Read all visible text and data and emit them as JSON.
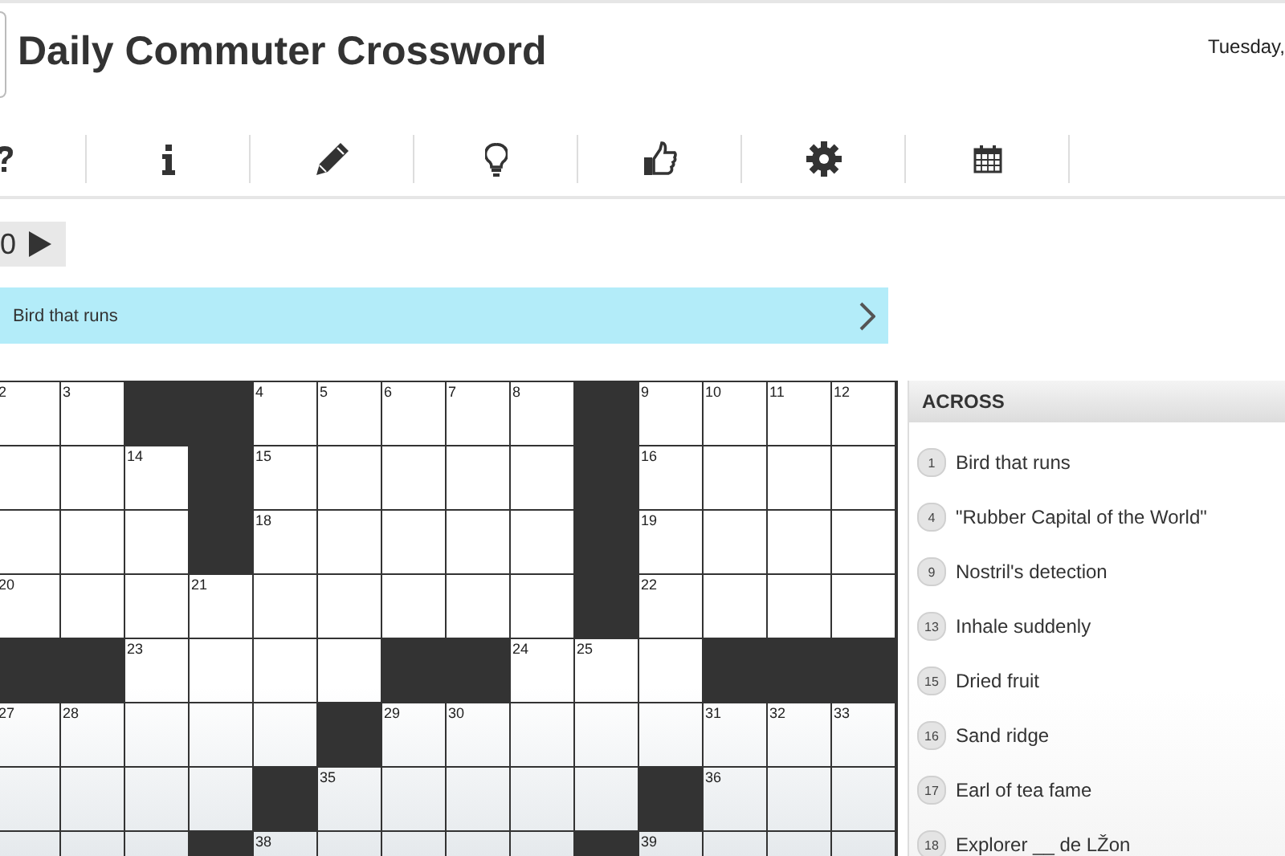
{
  "header": {
    "title": "Daily Commuter Crossword",
    "date": "Tuesday,"
  },
  "toolbar": [
    {
      "kind": "help"
    },
    {
      "kind": "info"
    },
    {
      "kind": "pencil"
    },
    {
      "kind": "bulb"
    },
    {
      "kind": "thumb"
    },
    {
      "kind": "gear"
    },
    {
      "kind": "calendar"
    }
  ],
  "timer": {
    "text": "0"
  },
  "clue_bar": {
    "text": "Bird that runs"
  },
  "grid": [
    [
      {
        "kind": "open",
        "number": "2"
      },
      {
        "kind": "open",
        "number": "3"
      },
      {
        "kind": "block"
      },
      {
        "kind": "block"
      },
      {
        "kind": "open",
        "number": "4"
      },
      {
        "kind": "open",
        "number": "5"
      },
      {
        "kind": "open",
        "number": "6"
      },
      {
        "kind": "open",
        "number": "7"
      },
      {
        "kind": "open",
        "number": "8"
      },
      {
        "kind": "block"
      },
      {
        "kind": "open",
        "number": "9"
      },
      {
        "kind": "open",
        "number": "10"
      },
      {
        "kind": "open",
        "number": "11"
      },
      {
        "kind": "open",
        "number": "12"
      }
    ],
    [
      {
        "kind": "open"
      },
      {
        "kind": "open"
      },
      {
        "kind": "open",
        "number": "14"
      },
      {
        "kind": "block"
      },
      {
        "kind": "open",
        "number": "15"
      },
      {
        "kind": "open"
      },
      {
        "kind": "open"
      },
      {
        "kind": "open"
      },
      {
        "kind": "open"
      },
      {
        "kind": "block"
      },
      {
        "kind": "open",
        "number": "16"
      },
      {
        "kind": "open"
      },
      {
        "kind": "open"
      },
      {
        "kind": "open"
      }
    ],
    [
      {
        "kind": "open"
      },
      {
        "kind": "open"
      },
      {
        "kind": "open"
      },
      {
        "kind": "block"
      },
      {
        "kind": "open",
        "number": "18"
      },
      {
        "kind": "open"
      },
      {
        "kind": "open"
      },
      {
        "kind": "open"
      },
      {
        "kind": "open"
      },
      {
        "kind": "block"
      },
      {
        "kind": "open",
        "number": "19"
      },
      {
        "kind": "open"
      },
      {
        "kind": "open"
      },
      {
        "kind": "open"
      }
    ],
    [
      {
        "kind": "open",
        "number": "20"
      },
      {
        "kind": "open"
      },
      {
        "kind": "open"
      },
      {
        "kind": "open",
        "number": "21"
      },
      {
        "kind": "open"
      },
      {
        "kind": "open"
      },
      {
        "kind": "open"
      },
      {
        "kind": "open"
      },
      {
        "kind": "open"
      },
      {
        "kind": "block"
      },
      {
        "kind": "open",
        "number": "22"
      },
      {
        "kind": "open"
      },
      {
        "kind": "open"
      },
      {
        "kind": "open"
      }
    ],
    [
      {
        "kind": "block"
      },
      {
        "kind": "block"
      },
      {
        "kind": "open",
        "number": "23"
      },
      {
        "kind": "open"
      },
      {
        "kind": "open"
      },
      {
        "kind": "open"
      },
      {
        "kind": "block"
      },
      {
        "kind": "block"
      },
      {
        "kind": "open",
        "number": "24"
      },
      {
        "kind": "open",
        "number": "25"
      },
      {
        "kind": "open"
      },
      {
        "kind": "block"
      },
      {
        "kind": "block"
      },
      {
        "kind": "block"
      }
    ],
    [
      {
        "kind": "open",
        "number": "27"
      },
      {
        "kind": "open",
        "number": "28"
      },
      {
        "kind": "open"
      },
      {
        "kind": "open"
      },
      {
        "kind": "open"
      },
      {
        "kind": "block"
      },
      {
        "kind": "open",
        "number": "29"
      },
      {
        "kind": "open",
        "number": "30"
      },
      {
        "kind": "open"
      },
      {
        "kind": "open"
      },
      {
        "kind": "open"
      },
      {
        "kind": "open",
        "number": "31"
      },
      {
        "kind": "open",
        "number": "32"
      },
      {
        "kind": "open",
        "number": "33"
      }
    ],
    [
      {
        "kind": "open"
      },
      {
        "kind": "open"
      },
      {
        "kind": "open"
      },
      {
        "kind": "open"
      },
      {
        "kind": "block"
      },
      {
        "kind": "open",
        "number": "35"
      },
      {
        "kind": "open"
      },
      {
        "kind": "open"
      },
      {
        "kind": "open"
      },
      {
        "kind": "open"
      },
      {
        "kind": "block"
      },
      {
        "kind": "open",
        "number": "36"
      },
      {
        "kind": "open"
      },
      {
        "kind": "open"
      }
    ],
    [
      {
        "kind": "open"
      },
      {
        "kind": "open"
      },
      {
        "kind": "open"
      },
      {
        "kind": "block"
      },
      {
        "kind": "open",
        "number": "38"
      },
      {
        "kind": "open"
      },
      {
        "kind": "open"
      },
      {
        "kind": "open"
      },
      {
        "kind": "open"
      },
      {
        "kind": "block"
      },
      {
        "kind": "open",
        "number": "39"
      },
      {
        "kind": "open"
      },
      {
        "kind": "open"
      },
      {
        "kind": "open"
      }
    ]
  ],
  "across": {
    "title": "ACROSS",
    "clues": [
      {
        "number": "1",
        "text": "Bird that runs"
      },
      {
        "number": "4",
        "text": "\"Rubber Capital of the World\""
      },
      {
        "number": "9",
        "text": "Nostril's detection"
      },
      {
        "number": "13",
        "text": "Inhale suddenly"
      },
      {
        "number": "15",
        "text": "Dried fruit"
      },
      {
        "number": "16",
        "text": "Sand ridge"
      },
      {
        "number": "17",
        "text": "Earl of tea fame"
      },
      {
        "number": "18",
        "text": "Explorer __ de LŽon"
      }
    ]
  }
}
